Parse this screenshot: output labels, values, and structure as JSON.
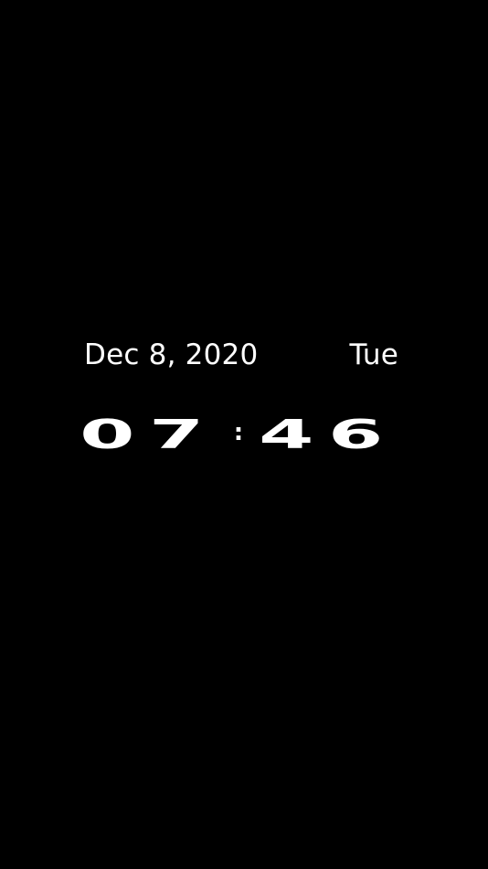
{
  "lockscreen": {
    "date": "Dec 8, 2020",
    "weekday": "Tue",
    "time": {
      "hours": "07",
      "separator": ":",
      "minutes": "46"
    }
  },
  "colors": {
    "background": "#000000",
    "text": "#ffffff"
  }
}
